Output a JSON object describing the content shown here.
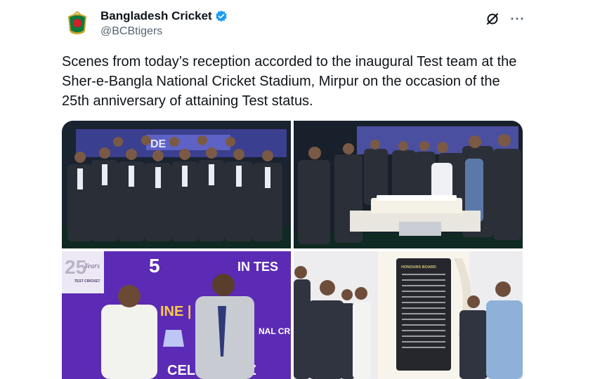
{
  "tweet": {
    "author": {
      "display_name": "Bangladesh Cricket",
      "handle": "@BCBtigers",
      "verified": true,
      "avatar_icon": "bcb-logo-icon"
    },
    "text": "Scenes from today’s reception accorded to the inaugural Test team at the Sher-e-Bangla National Cricket Stadium, Mirpur on the occasion of the 25th anniversary of attaining Test status.",
    "actions": {
      "grok_icon": "grok-icon",
      "more_label": "···"
    },
    "media": [
      {
        "icon": "team-photo",
        "overlay_text": "DE"
      },
      {
        "icon": "cake-cutting-photo",
        "overlay_text": ""
      },
      {
        "icon": "award-photo",
        "overlay_texts": [
          "25",
          "Years",
          "TEST CRICKET",
          "IN TES",
          "INE | TE",
          "NAL CR",
          "CELEBRALIZ"
        ]
      },
      {
        "icon": "plaque-unveiling-photo",
        "overlay_texts": [
          "HONOURS BOARD"
        ]
      }
    ]
  },
  "colors": {
    "text": "#0f1419",
    "muted": "#536471",
    "verified_blue": "#1d9bf0",
    "stage_purple": "#5b2bb5"
  }
}
